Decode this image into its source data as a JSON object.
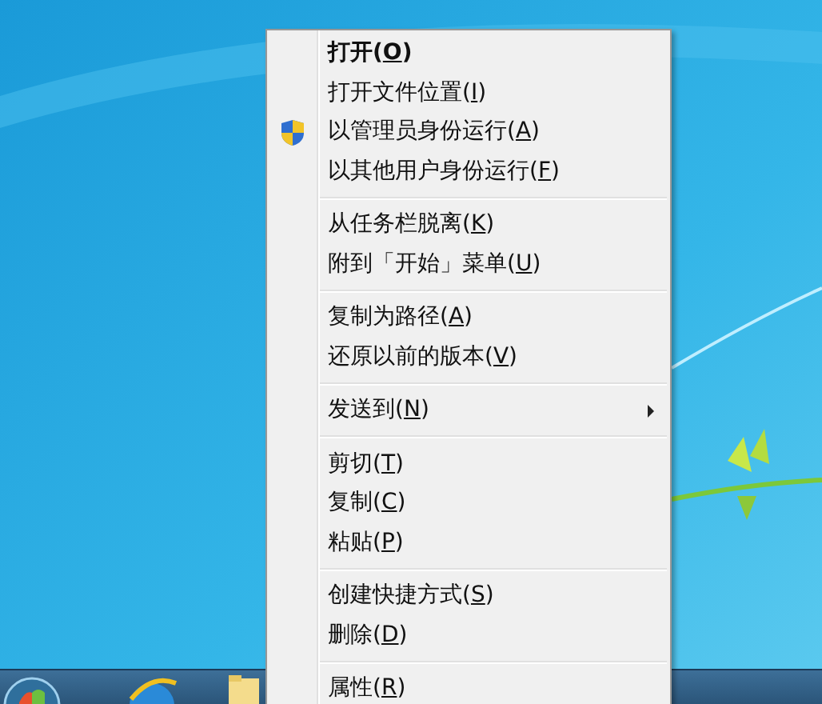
{
  "context_menu": {
    "items": [
      {
        "kind": "item",
        "prefix": "打开(",
        "key": "O",
        "suffix": ")",
        "default": true
      },
      {
        "kind": "item",
        "prefix": "打开文件位置(",
        "key": "I",
        "suffix": ")"
      },
      {
        "kind": "item",
        "prefix": "以管理员身份运行(",
        "key": "A",
        "suffix": ")",
        "elevated": true
      },
      {
        "kind": "item",
        "prefix": "以其他用户身份运行(",
        "key": "F",
        "suffix": ")"
      },
      {
        "kind": "separator"
      },
      {
        "kind": "item",
        "prefix": "从任务栏脱离(",
        "key": "K",
        "suffix": ")"
      },
      {
        "kind": "item",
        "prefix": "附到「开始」菜单(",
        "key": "U",
        "suffix": ")"
      },
      {
        "kind": "separator"
      },
      {
        "kind": "item",
        "prefix": "复制为路径(",
        "key": "A",
        "suffix": ")"
      },
      {
        "kind": "item",
        "prefix": "还原以前的版本(",
        "key": "V",
        "suffix": ")"
      },
      {
        "kind": "separator"
      },
      {
        "kind": "item",
        "prefix": "发送到(",
        "key": "N",
        "suffix": ")",
        "submenu": true
      },
      {
        "kind": "separator"
      },
      {
        "kind": "item",
        "prefix": "剪切(",
        "key": "T",
        "suffix": ")"
      },
      {
        "kind": "item",
        "prefix": "复制(",
        "key": "C",
        "suffix": ")"
      },
      {
        "kind": "item",
        "prefix": "粘贴(",
        "key": "P",
        "suffix": ")"
      },
      {
        "kind": "separator"
      },
      {
        "kind": "item",
        "prefix": "创建快捷方式(",
        "key": "S",
        "suffix": ")"
      },
      {
        "kind": "item",
        "prefix": "删除(",
        "key": "D",
        "suffix": ")"
      },
      {
        "kind": "separator"
      },
      {
        "kind": "item",
        "prefix": "属性(",
        "key": "R",
        "suffix": ")"
      }
    ]
  }
}
